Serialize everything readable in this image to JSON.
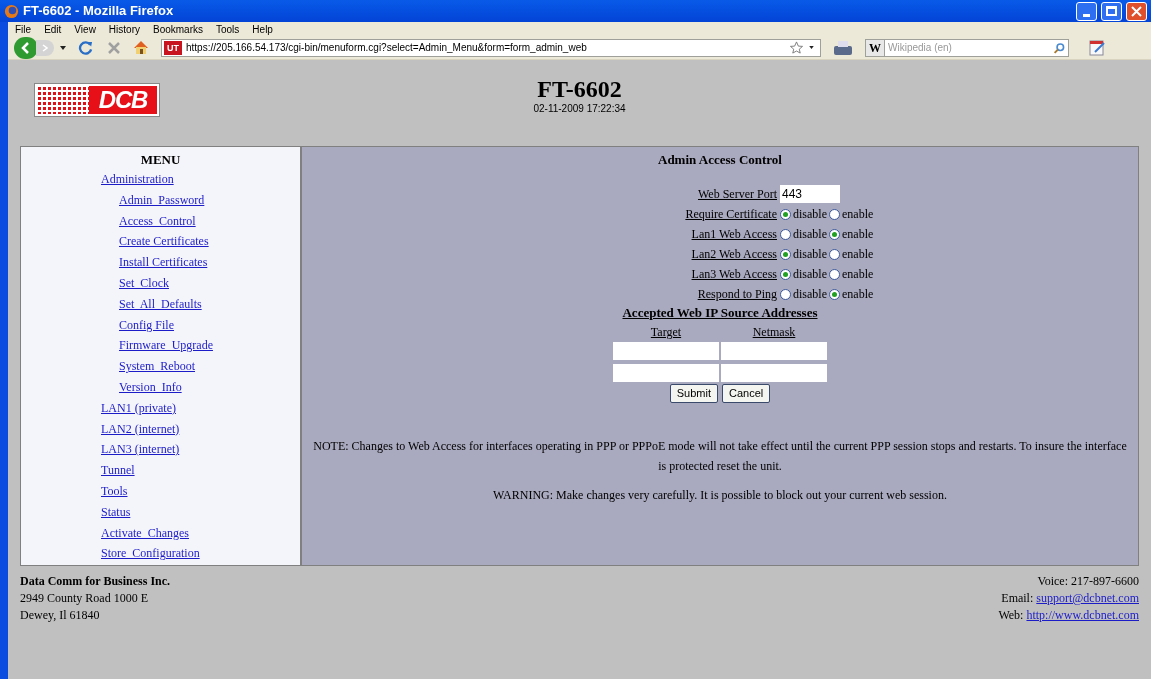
{
  "window": {
    "title": "FT-6602 - Mozilla Firefox"
  },
  "menu_bar": [
    "File",
    "Edit",
    "View",
    "History",
    "Bookmarks",
    "Tools",
    "Help"
  ],
  "address_bar": {
    "site_badge": "UT",
    "url": "https://205.166.54.173/cgi-bin/menuform.cgi?select=Admin_Menu&form=form_admin_web"
  },
  "search": {
    "engine": "W",
    "placeholder": "Wikipedia (en)"
  },
  "header": {
    "logo_text": "DCB",
    "title": "FT-6602",
    "datetime": "02-11-2009 17:22:34"
  },
  "sidebar": {
    "title": "MENU",
    "items": [
      {
        "label": "Administration",
        "children": [
          {
            "label": "Admin  Password"
          },
          {
            "label": "Access  Control"
          },
          {
            "label": "Create Certificates"
          },
          {
            "label": "Install Certificates"
          },
          {
            "label": "Set  Clock"
          },
          {
            "label": "Set  All  Defaults"
          },
          {
            "label": "Config File"
          },
          {
            "label": "Firmware  Upgrade"
          },
          {
            "label": "System  Reboot"
          },
          {
            "label": "Version  Info"
          }
        ]
      },
      {
        "label": "LAN1 (private)"
      },
      {
        "label": "LAN2 (internet)"
      },
      {
        "label": "LAN3 (internet)"
      },
      {
        "label": "Tunnel"
      },
      {
        "label": "Tools"
      },
      {
        "label": "Status"
      },
      {
        "label": "Activate  Changes"
      },
      {
        "label": "Store  Configuration"
      }
    ]
  },
  "form": {
    "title": "Admin Access Control",
    "fields": [
      {
        "label": "Web Server Port",
        "kind": "text",
        "value": "443"
      },
      {
        "label": "Require Certificate",
        "kind": "radio",
        "options": [
          {
            "label": "disable",
            "selected": true
          },
          {
            "label": "enable",
            "selected": false
          }
        ]
      },
      {
        "label": "Lan1 Web Access",
        "kind": "radio",
        "options": [
          {
            "label": "disable",
            "selected": false
          },
          {
            "label": "enable",
            "selected": true
          }
        ]
      },
      {
        "label": "Lan2 Web Access",
        "kind": "radio",
        "options": [
          {
            "label": "disable",
            "selected": true
          },
          {
            "label": "enable",
            "selected": false
          }
        ]
      },
      {
        "label": "Lan3 Web Access",
        "kind": "radio",
        "options": [
          {
            "label": "disable",
            "selected": true
          },
          {
            "label": "enable",
            "selected": false
          }
        ]
      },
      {
        "label": "Respond to Ping",
        "kind": "radio",
        "options": [
          {
            "label": "disable",
            "selected": false
          },
          {
            "label": "enable",
            "selected": true
          }
        ]
      }
    ],
    "addresses_title": "Accepted Web IP Source Addresses",
    "columns": [
      "Target",
      "Netmask"
    ],
    "buttons": [
      "Submit",
      "Cancel"
    ],
    "note": "NOTE: Changes to Web Access for interfaces operating in PPP or PPPoE mode will not take effect until the current PPP session stops and restarts. To insure the interface is protected reset the unit.",
    "warning": "WARNING: Make changes very carefully. It is possible to block out your current web session."
  },
  "footer": {
    "company": "Data Comm for Business Inc.",
    "address": [
      "2949 County Road 1000 E",
      "Dewey, Il 61840"
    ],
    "contacts": [
      {
        "label": "Voice: ",
        "value": "217-897-6600",
        "kind": "text"
      },
      {
        "label": "Email: ",
        "value": "support@dcbnet.com",
        "kind": "link"
      },
      {
        "label": "Web: ",
        "value": "http://www.dcbnet.com",
        "kind": "link"
      }
    ]
  }
}
